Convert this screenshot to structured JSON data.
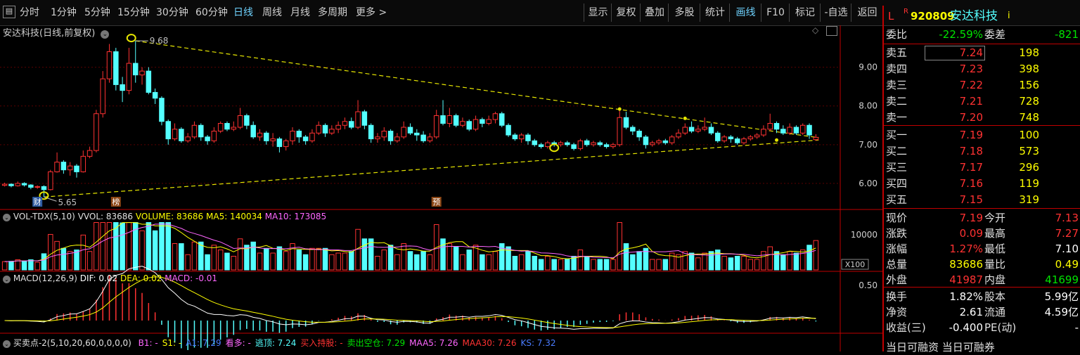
{
  "toolbar": {
    "left_tabs": [
      "分时",
      "1分钟",
      "5分钟",
      "15分钟",
      "30分钟",
      "60分钟",
      "日线",
      "周线",
      "月线",
      "多周期",
      "更多 >"
    ],
    "active_tab": "日线",
    "right_tabs": [
      "显示",
      "复权",
      "叠加",
      "多股",
      "统计",
      "画线",
      "F10",
      "标记",
      "-自选",
      "返回"
    ],
    "active_right": "画线"
  },
  "stock": {
    "code_prefix": "L",
    "r_mark": "R",
    "code": "920809",
    "name": "安达科技",
    "info_icon": "i",
    "chart_title": "安达科技(日线,前复权)"
  },
  "order_book": {
    "weibi_label": "委比",
    "weibi_value": "-22.59%",
    "weicha_label": "委差",
    "weicha_value": "-821",
    "asks": [
      {
        "label": "卖五",
        "price": "7.24",
        "vol": "198"
      },
      {
        "label": "卖四",
        "price": "7.23",
        "vol": "398"
      },
      {
        "label": "卖三",
        "price": "7.22",
        "vol": "156"
      },
      {
        "label": "卖二",
        "price": "7.21",
        "vol": "728"
      },
      {
        "label": "卖一",
        "price": "7.20",
        "vol": "748"
      }
    ],
    "bids": [
      {
        "label": "买一",
        "price": "7.19",
        "vol": "100"
      },
      {
        "label": "买二",
        "price": "7.18",
        "vol": "573"
      },
      {
        "label": "买三",
        "price": "7.17",
        "vol": "296"
      },
      {
        "label": "买四",
        "price": "7.16",
        "vol": "119"
      },
      {
        "label": "买五",
        "price": "7.15",
        "vol": "319"
      }
    ]
  },
  "quote": {
    "rows": [
      {
        "l1": "现价",
        "v1": "7.19",
        "c1": "red",
        "l2": "今开",
        "v2": "7.13",
        "c2": "red"
      },
      {
        "l1": "涨跌",
        "v1": "0.09",
        "c1": "red",
        "l2": "最高",
        "v2": "7.27",
        "c2": "red"
      },
      {
        "l1": "涨幅",
        "v1": "1.27%",
        "c1": "red",
        "l2": "最低",
        "v2": "7.10",
        "c2": "white"
      },
      {
        "l1": "总量",
        "v1": "83686",
        "c1": "yellow",
        "l2": "量比",
        "v2": "0.49",
        "c2": "yellow"
      },
      {
        "l1": "外盘",
        "v1": "41987",
        "c1": "red",
        "l2": "内盘",
        "v2": "41699",
        "c2": "green"
      },
      {
        "l1": "换手",
        "v1": "1.82%",
        "c1": "white",
        "l2": "股本",
        "v2": "5.99亿",
        "c2": "white"
      },
      {
        "l1": "净资",
        "v1": "2.61",
        "c1": "white",
        "l2": "流通",
        "v2": "4.59亿",
        "c2": "white"
      },
      {
        "l1": "收益(三)",
        "v1": "-0.400",
        "c1": "white",
        "l2": "PE(动)",
        "v2": "-",
        "c2": "white"
      }
    ],
    "bottom_cut": "当日可融资 当日可融券"
  },
  "chart_data": {
    "type": "candlestick",
    "title": "安达科技(日线,前复权)",
    "price_axis": {
      "ticks": [
        9.0,
        8.0,
        7.0,
        6.0
      ],
      "range": [
        5.4,
        9.9
      ]
    },
    "annotations": {
      "high": "9.68",
      "low": "5.65",
      "markers": [
        "财",
        "榜",
        "预"
      ]
    },
    "volume": {
      "title": "VOL-TDX(5,10)",
      "vvol": "VVOL: 83686",
      "volume": "VOLUME: 83686",
      "ma5": "MA5: 140034",
      "ma10": "MA10: 173085",
      "tick": "10000",
      "unit": "X100"
    },
    "macd": {
      "title": "MACD(12,26,9)",
      "dif": "DIF: 0.02",
      "dea": "DEA: 0.02",
      "macd": "MACD: -0.01",
      "tick": "0.50"
    },
    "bottom": {
      "title": "买卖点-2(5,10,20,60,0,0,0,0)",
      "items": [
        {
          "text": "B1: -",
          "color": "#ff66ff"
        },
        {
          "text": "S1: -",
          "color": "#ffff00"
        },
        {
          "text": "A1: 7.29",
          "color": "#4a7cff"
        },
        {
          "text": "看多: -",
          "color": "#ff66ff"
        },
        {
          "text": "逃顶: 7.24",
          "color": "#54ffff"
        },
        {
          "text": "买入持股: -",
          "color": "#ff3232"
        },
        {
          "text": "卖出空仓: 7.29",
          "color": "#00e400"
        },
        {
          "text": "MAA5: 7.26",
          "color": "#ff66ff"
        },
        {
          "text": "MAA30: 7.26",
          "color": "#ff3232"
        },
        {
          "text": "KS: 7.32",
          "color": "#4a7cff"
        }
      ]
    },
    "candles": [
      {
        "o": 5.95,
        "c": 5.98,
        "h": 6.02,
        "l": 5.92
      },
      {
        "o": 5.98,
        "c": 5.94,
        "h": 6.0,
        "l": 5.9
      },
      {
        "o": 5.94,
        "c": 6.0,
        "h": 6.05,
        "l": 5.92
      },
      {
        "o": 6.0,
        "c": 5.96,
        "h": 6.03,
        "l": 5.92
      },
      {
        "o": 5.96,
        "c": 5.9,
        "h": 5.98,
        "l": 5.85
      },
      {
        "o": 5.9,
        "c": 5.92,
        "h": 5.95,
        "l": 5.86
      },
      {
        "o": 5.92,
        "c": 5.84,
        "h": 5.95,
        "l": 5.65
      },
      {
        "o": 5.84,
        "c": 6.3,
        "h": 6.35,
        "l": 5.82
      },
      {
        "o": 6.3,
        "c": 6.55,
        "h": 6.8,
        "l": 6.28
      },
      {
        "o": 6.55,
        "c": 6.35,
        "h": 6.6,
        "l": 6.25
      },
      {
        "o": 6.35,
        "c": 6.45,
        "h": 6.55,
        "l": 6.2
      },
      {
        "o": 6.45,
        "c": 6.3,
        "h": 6.5,
        "l": 6.15
      },
      {
        "o": 6.3,
        "c": 6.7,
        "h": 6.85,
        "l": 6.28
      },
      {
        "o": 6.7,
        "c": 6.85,
        "h": 6.95,
        "l": 6.65
      },
      {
        "o": 6.85,
        "c": 7.8,
        "h": 7.9,
        "l": 6.8
      },
      {
        "o": 7.8,
        "c": 8.7,
        "h": 8.9,
        "l": 7.7
      },
      {
        "o": 8.7,
        "c": 9.4,
        "h": 9.6,
        "l": 8.6
      },
      {
        "o": 9.4,
        "c": 8.55,
        "h": 9.5,
        "l": 8.4
      },
      {
        "o": 8.55,
        "c": 8.4,
        "h": 8.75,
        "l": 8.1
      },
      {
        "o": 8.4,
        "c": 9.1,
        "h": 9.5,
        "l": 8.3
      },
      {
        "o": 9.1,
        "c": 8.8,
        "h": 9.68,
        "l": 8.6
      },
      {
        "o": 8.8,
        "c": 8.9,
        "h": 9.0,
        "l": 8.55
      },
      {
        "o": 8.9,
        "c": 8.35,
        "h": 9.0,
        "l": 8.3
      },
      {
        "o": 8.35,
        "c": 8.2,
        "h": 8.45,
        "l": 8.05
      },
      {
        "o": 8.2,
        "c": 7.6,
        "h": 8.25,
        "l": 7.5
      },
      {
        "o": 7.6,
        "c": 7.15,
        "h": 7.65,
        "l": 7.0
      },
      {
        "o": 7.15,
        "c": 7.4,
        "h": 7.55,
        "l": 7.1
      },
      {
        "o": 7.4,
        "c": 7.1,
        "h": 7.45,
        "l": 7.05
      },
      {
        "o": 7.1,
        "c": 7.2,
        "h": 7.3,
        "l": 7.05
      },
      {
        "o": 7.2,
        "c": 7.5,
        "h": 7.6,
        "l": 7.15
      },
      {
        "o": 7.5,
        "c": 7.2,
        "h": 7.55,
        "l": 7.1
      },
      {
        "o": 7.2,
        "c": 7.1,
        "h": 7.25,
        "l": 7.0
      },
      {
        "o": 7.1,
        "c": 7.35,
        "h": 7.45,
        "l": 7.05
      },
      {
        "o": 7.35,
        "c": 7.55,
        "h": 7.6,
        "l": 7.3
      },
      {
        "o": 7.55,
        "c": 7.4,
        "h": 7.6,
        "l": 7.35
      },
      {
        "o": 7.4,
        "c": 7.45,
        "h": 7.6,
        "l": 7.35
      },
      {
        "o": 7.45,
        "c": 7.75,
        "h": 7.95,
        "l": 7.4
      },
      {
        "o": 7.75,
        "c": 7.5,
        "h": 7.8,
        "l": 7.4
      },
      {
        "o": 7.5,
        "c": 7.2,
        "h": 7.6,
        "l": 7.15
      },
      {
        "o": 7.2,
        "c": 7.3,
        "h": 7.4,
        "l": 7.1
      },
      {
        "o": 7.3,
        "c": 7.1,
        "h": 7.35,
        "l": 7.0
      },
      {
        "o": 7.1,
        "c": 7.15,
        "h": 7.3,
        "l": 6.95
      },
      {
        "o": 7.15,
        "c": 6.95,
        "h": 7.2,
        "l": 6.8
      },
      {
        "o": 6.95,
        "c": 7.1,
        "h": 7.15,
        "l": 6.85
      },
      {
        "o": 7.1,
        "c": 7.35,
        "h": 7.45,
        "l": 7.0
      },
      {
        "o": 7.35,
        "c": 7.2,
        "h": 7.4,
        "l": 7.05
      },
      {
        "o": 7.2,
        "c": 7.1,
        "h": 7.25,
        "l": 7.0
      },
      {
        "o": 7.1,
        "c": 7.3,
        "h": 7.4,
        "l": 7.05
      },
      {
        "o": 7.3,
        "c": 7.5,
        "h": 7.6,
        "l": 7.25
      },
      {
        "o": 7.5,
        "c": 7.3,
        "h": 7.55,
        "l": 7.2
      },
      {
        "o": 7.3,
        "c": 7.4,
        "h": 7.5,
        "l": 7.25
      },
      {
        "o": 7.4,
        "c": 7.5,
        "h": 7.6,
        "l": 7.3
      },
      {
        "o": 7.5,
        "c": 7.6,
        "h": 7.7,
        "l": 7.4
      },
      {
        "o": 7.6,
        "c": 7.45,
        "h": 7.7,
        "l": 7.4
      },
      {
        "o": 7.45,
        "c": 7.85,
        "h": 8.15,
        "l": 7.4
      },
      {
        "o": 7.85,
        "c": 7.5,
        "h": 7.9,
        "l": 7.4
      },
      {
        "o": 7.5,
        "c": 7.15,
        "h": 7.55,
        "l": 7.05
      },
      {
        "o": 7.15,
        "c": 7.2,
        "h": 7.3,
        "l": 7.05
      },
      {
        "o": 7.2,
        "c": 7.35,
        "h": 7.45,
        "l": 7.1
      },
      {
        "o": 7.35,
        "c": 7.1,
        "h": 7.4,
        "l": 7.0
      },
      {
        "o": 7.1,
        "c": 7.2,
        "h": 7.3,
        "l": 7.05
      },
      {
        "o": 7.2,
        "c": 7.45,
        "h": 7.6,
        "l": 7.15
      },
      {
        "o": 7.45,
        "c": 7.3,
        "h": 7.55,
        "l": 7.25
      },
      {
        "o": 7.3,
        "c": 7.25,
        "h": 7.4,
        "l": 7.1
      },
      {
        "o": 7.25,
        "c": 7.1,
        "h": 7.35,
        "l": 7.05
      },
      {
        "o": 7.1,
        "c": 7.2,
        "h": 7.3,
        "l": 7.05
      },
      {
        "o": 7.2,
        "c": 7.75,
        "h": 7.9,
        "l": 7.15
      },
      {
        "o": 7.75,
        "c": 7.55,
        "h": 8.15,
        "l": 7.5
      },
      {
        "o": 7.55,
        "c": 7.75,
        "h": 7.95,
        "l": 7.45
      },
      {
        "o": 7.75,
        "c": 7.5,
        "h": 7.8,
        "l": 7.45
      },
      {
        "o": 7.5,
        "c": 7.6,
        "h": 7.7,
        "l": 7.45
      },
      {
        "o": 7.6,
        "c": 7.4,
        "h": 7.65,
        "l": 7.35
      },
      {
        "o": 7.4,
        "c": 7.65,
        "h": 7.75,
        "l": 7.35
      },
      {
        "o": 7.65,
        "c": 7.55,
        "h": 7.7,
        "l": 7.45
      },
      {
        "o": 7.55,
        "c": 7.65,
        "h": 7.75,
        "l": 7.5
      },
      {
        "o": 7.65,
        "c": 7.8,
        "h": 7.85,
        "l": 7.55
      },
      {
        "o": 7.8,
        "c": 7.5,
        "h": 7.85,
        "l": 7.45
      },
      {
        "o": 7.5,
        "c": 7.25,
        "h": 7.55,
        "l": 7.2
      },
      {
        "o": 7.25,
        "c": 7.15,
        "h": 7.3,
        "l": 7.1
      },
      {
        "o": 7.15,
        "c": 7.25,
        "h": 7.3,
        "l": 7.05
      },
      {
        "o": 7.25,
        "c": 7.1,
        "h": 7.3,
        "l": 7.0
      },
      {
        "o": 7.1,
        "c": 7.0,
        "h": 7.15,
        "l": 6.95
      },
      {
        "o": 7.0,
        "c": 6.95,
        "h": 7.05,
        "l": 6.9
      },
      {
        "o": 6.95,
        "c": 7.05,
        "h": 7.1,
        "l": 6.9
      },
      {
        "o": 7.05,
        "c": 7.0,
        "h": 7.1,
        "l": 6.95
      },
      {
        "o": 7.0,
        "c": 7.05,
        "h": 7.1,
        "l": 6.95
      },
      {
        "o": 7.05,
        "c": 7.0,
        "h": 7.1,
        "l": 6.95
      },
      {
        "o": 7.0,
        "c": 6.9,
        "h": 7.05,
        "l": 6.85
      },
      {
        "o": 6.9,
        "c": 7.1,
        "h": 7.15,
        "l": 6.85
      },
      {
        "o": 7.1,
        "c": 7.0,
        "h": 7.15,
        "l": 6.95
      },
      {
        "o": 7.0,
        "c": 7.05,
        "h": 7.1,
        "l": 6.95
      },
      {
        "o": 7.05,
        "c": 7.0,
        "h": 7.1,
        "l": 6.95
      },
      {
        "o": 7.0,
        "c": 6.95,
        "h": 7.05,
        "l": 6.9
      },
      {
        "o": 6.95,
        "c": 7.0,
        "h": 7.05,
        "l": 6.9
      },
      {
        "o": 7.0,
        "c": 7.7,
        "h": 7.9,
        "l": 6.95
      },
      {
        "o": 7.7,
        "c": 7.45,
        "h": 7.85,
        "l": 7.4
      },
      {
        "o": 7.45,
        "c": 7.35,
        "h": 7.5,
        "l": 7.25
      },
      {
        "o": 7.35,
        "c": 7.2,
        "h": 7.4,
        "l": 7.1
      },
      {
        "o": 7.2,
        "c": 7.0,
        "h": 7.25,
        "l": 6.9
      },
      {
        "o": 7.0,
        "c": 7.05,
        "h": 7.1,
        "l": 6.95
      },
      {
        "o": 7.05,
        "c": 7.1,
        "h": 7.15,
        "l": 7.0
      },
      {
        "o": 7.1,
        "c": 7.05,
        "h": 7.15,
        "l": 7.0
      },
      {
        "o": 7.05,
        "c": 7.2,
        "h": 7.25,
        "l": 7.0
      },
      {
        "o": 7.2,
        "c": 7.3,
        "h": 7.4,
        "l": 7.15
      },
      {
        "o": 7.3,
        "c": 7.45,
        "h": 7.55,
        "l": 7.25
      },
      {
        "o": 7.45,
        "c": 7.35,
        "h": 7.6,
        "l": 7.3
      },
      {
        "o": 7.35,
        "c": 7.4,
        "h": 7.5,
        "l": 7.3
      },
      {
        "o": 7.4,
        "c": 7.45,
        "h": 7.7,
        "l": 7.35
      },
      {
        "o": 7.45,
        "c": 7.3,
        "h": 7.55,
        "l": 7.25
      },
      {
        "o": 7.3,
        "c": 7.1,
        "h": 7.35,
        "l": 7.05
      },
      {
        "o": 7.1,
        "c": 7.2,
        "h": 7.25,
        "l": 7.05
      },
      {
        "o": 7.2,
        "c": 7.15,
        "h": 7.25,
        "l": 7.05
      },
      {
        "o": 7.15,
        "c": 7.05,
        "h": 7.2,
        "l": 7.0
      },
      {
        "o": 7.05,
        "c": 7.15,
        "h": 7.2,
        "l": 7.0
      },
      {
        "o": 7.15,
        "c": 7.2,
        "h": 7.25,
        "l": 7.1
      },
      {
        "o": 7.2,
        "c": 7.25,
        "h": 7.3,
        "l": 7.15
      },
      {
        "o": 7.25,
        "c": 7.4,
        "h": 7.5,
        "l": 7.2
      },
      {
        "o": 7.4,
        "c": 7.55,
        "h": 7.8,
        "l": 7.35
      },
      {
        "o": 7.55,
        "c": 7.4,
        "h": 7.6,
        "l": 7.3
      },
      {
        "o": 7.4,
        "c": 7.3,
        "h": 7.5,
        "l": 7.25
      },
      {
        "o": 7.3,
        "c": 7.45,
        "h": 7.55,
        "l": 7.25
      },
      {
        "o": 7.45,
        "c": 7.3,
        "h": 7.5,
        "l": 7.25
      },
      {
        "o": 7.3,
        "c": 7.5,
        "h": 7.55,
        "l": 7.25
      },
      {
        "o": 7.5,
        "c": 7.25,
        "h": 7.55,
        "l": 7.15
      },
      {
        "o": 7.13,
        "c": 7.19,
        "h": 7.27,
        "l": 7.1
      }
    ]
  }
}
